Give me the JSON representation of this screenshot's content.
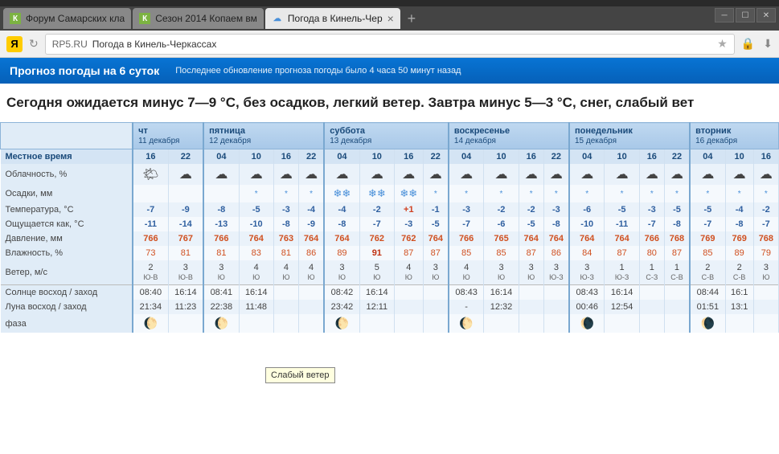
{
  "tabs": [
    {
      "icon": "К",
      "label": "Форум Самарских кла"
    },
    {
      "icon": "К",
      "label": "Сезон 2014 Копаем вм"
    },
    {
      "icon": "☁",
      "label": "Погода в Кинель-Чер",
      "active": true
    }
  ],
  "address": {
    "domain": "RP5.RU",
    "title": "Погода в Кинель-Черкассах"
  },
  "banner": {
    "title": "Прогноз погоды на 6 суток",
    "sub": "Последнее обновление прогноза погоды было 4 часа 50 минут назад"
  },
  "summary": "Сегодня ожидается минус 7—9 °С, без осадков, легкий ветер. Завтра минус 5—3 °С, снег, слабый вет",
  "days": [
    {
      "name": "чт",
      "date": "11 декабря",
      "cols": 2
    },
    {
      "name": "пятница",
      "date": "12 декабря",
      "cols": 4
    },
    {
      "name": "суббота",
      "date": "13 декабря",
      "cols": 4
    },
    {
      "name": "воскресенье",
      "date": "14 декабря",
      "cols": 4
    },
    {
      "name": "понедельник",
      "date": "15 декабря",
      "cols": 4
    },
    {
      "name": "вторник",
      "date": "16 декабря",
      "cols": 3
    }
  ],
  "rows": {
    "local_time": {
      "label": "Местное время",
      "vals": [
        "16",
        "22",
        "04",
        "10",
        "16",
        "22",
        "04",
        "10",
        "16",
        "22",
        "04",
        "10",
        "16",
        "22",
        "04",
        "10",
        "16",
        "22",
        "04",
        "10",
        "16"
      ]
    },
    "cloud": {
      "label": "Облачность, %",
      "vals": [
        "🌤",
        "☁",
        "☁",
        "☁",
        "☁",
        "☁",
        "☁",
        "☁",
        "☁",
        "☁",
        "☁",
        "☁",
        "☁",
        "☁",
        "☁",
        "☁",
        "☁",
        "☁",
        "☁",
        "☁",
        "☁"
      ]
    },
    "precip": {
      "label": "Осадки, мм",
      "vals": [
        "",
        "",
        "",
        "*",
        "*",
        "*",
        "❄❄",
        "❄❄",
        "❄❄",
        "*",
        "*",
        "*",
        "*",
        "*",
        "*",
        "*",
        "*",
        "*",
        "*",
        "*",
        "*"
      ]
    },
    "temp": {
      "label": "Температура, °C",
      "vals": [
        "-7",
        "-9",
        "-8",
        "-5",
        "-3",
        "-4",
        "-4",
        "-2",
        "+1",
        "-1",
        "-3",
        "-2",
        "-2",
        "-3",
        "-6",
        "-5",
        "-3",
        "-5",
        "-5",
        "-4",
        "-2"
      ]
    },
    "feels": {
      "label": "Ощущается как, °C",
      "vals": [
        "-11",
        "-14",
        "-13",
        "-10",
        "-8",
        "-9",
        "-8",
        "-7",
        "-3",
        "-5",
        "-7",
        "-6",
        "-5",
        "-8",
        "-10",
        "-11",
        "-7",
        "-8",
        "-7",
        "-8",
        "-7"
      ]
    },
    "press": {
      "label": "Давление, мм",
      "vals": [
        "766",
        "767",
        "766",
        "764",
        "763",
        "764",
        "764",
        "762",
        "762",
        "764",
        "766",
        "765",
        "764",
        "764",
        "764",
        "764",
        "766",
        "768",
        "769",
        "769",
        "768"
      ]
    },
    "humid": {
      "label": "Влажность, %",
      "vals": [
        "73",
        "81",
        "81",
        "83",
        "81",
        "86",
        "89",
        "91",
        "87",
        "87",
        "85",
        "85",
        "87",
        "86",
        "84",
        "87",
        "80",
        "87",
        "85",
        "89",
        "79"
      ]
    },
    "wind": {
      "label": "Ветер, м/с",
      "vals": [
        [
          "2",
          "Ю-В"
        ],
        [
          "3",
          "Ю-В"
        ],
        [
          "3",
          "Ю"
        ],
        [
          "4",
          "Ю"
        ],
        [
          "4",
          "Ю"
        ],
        [
          "4",
          "Ю"
        ],
        [
          "3",
          "Ю"
        ],
        [
          "5",
          "Ю"
        ],
        [
          "4",
          "Ю"
        ],
        [
          "3",
          "Ю"
        ],
        [
          "4",
          "Ю"
        ],
        [
          "3",
          "Ю"
        ],
        [
          "3",
          "Ю"
        ],
        [
          "3",
          "Ю-З"
        ],
        [
          "3",
          "Ю-З"
        ],
        [
          "1",
          "Ю-З"
        ],
        [
          "1",
          "С-З"
        ],
        [
          "1",
          "С-В"
        ],
        [
          "2",
          "С-В"
        ],
        [
          "2",
          "С-В"
        ],
        [
          "3",
          "Ю"
        ]
      ]
    },
    "sun": {
      "label": "Солнце восход / заход",
      "vals": [
        "08:40",
        "16:14",
        "08:41",
        "16:14",
        "",
        "",
        "08:42",
        "16:14",
        "",
        "",
        "08:43",
        "16:14",
        "",
        "",
        "08:43",
        "16:14",
        "",
        "",
        "08:44",
        "16:1",
        ""
      ]
    },
    "moon": {
      "label": "Луна восход / заход",
      "vals": [
        "21:34",
        "11:23",
        "22:38",
        "11:48",
        "",
        "",
        "23:42",
        "12:11",
        "",
        "",
        "-",
        "12:32",
        "",
        "",
        "00:46",
        "12:54",
        "",
        "",
        "01:51",
        "13:1",
        ""
      ]
    },
    "phase": {
      "label": "фаза",
      "vals": [
        "🌔",
        "",
        "🌔",
        "",
        "",
        "",
        "🌔",
        "",
        "",
        "",
        "🌔",
        "",
        "",
        "",
        "🌘",
        "",
        "",
        "",
        "🌘",
        "",
        ""
      ]
    }
  },
  "tooltip": "Слабый ветер"
}
